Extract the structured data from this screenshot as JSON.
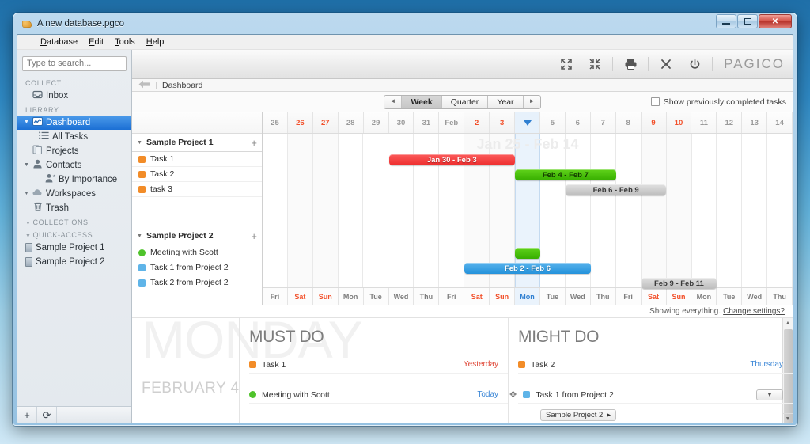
{
  "window": {
    "title": "A new database.pgco",
    "icon": "app-icon",
    "buttons": {
      "minimize": "–",
      "maximize": "□",
      "close": "✕"
    }
  },
  "menubar": [
    {
      "label": "Database",
      "accel": "D"
    },
    {
      "label": "Edit",
      "accel": "E"
    },
    {
      "label": "Tools",
      "accel": "T"
    },
    {
      "label": "Help",
      "accel": "H"
    }
  ],
  "sidebar": {
    "search_placeholder": "Type to search...",
    "sections": [
      {
        "header": "COLLECT",
        "collapsible": false,
        "items": [
          {
            "label": "Inbox",
            "icon": "inbox-icon",
            "glyph": "✉",
            "indent": 0,
            "twisty": "",
            "selected": false
          }
        ]
      },
      {
        "header": "LIBRARY",
        "collapsible": false,
        "items": [
          {
            "label": "Dashboard",
            "icon": "dashboard-icon",
            "glyph": "➤",
            "indent": 0,
            "twisty": "▼",
            "selected": true
          },
          {
            "label": "All Tasks",
            "icon": "list-icon",
            "glyph": "☰",
            "indent": 1,
            "twisty": "",
            "selected": false
          },
          {
            "label": "Projects",
            "icon": "projects-icon",
            "glyph": "❐",
            "indent": 0,
            "twisty": "",
            "selected": false
          },
          {
            "label": "Contacts",
            "icon": "contacts-icon",
            "glyph": "♟",
            "indent": 0,
            "twisty": "▼",
            "selected": false
          },
          {
            "label": "By Importance",
            "icon": "person-star-icon",
            "glyph": "♟",
            "indent": 2,
            "twisty": "",
            "selected": false
          },
          {
            "label": "Workspaces",
            "icon": "cloud-icon",
            "glyph": "☁",
            "indent": 0,
            "twisty": "▼",
            "selected": false
          },
          {
            "label": "Trash",
            "icon": "trash-icon",
            "glyph": "⌧",
            "indent": 0,
            "twisty": "",
            "selected": false
          }
        ]
      },
      {
        "header": "COLLECTIONS",
        "collapsible": true,
        "items": []
      },
      {
        "header": "QUICK-ACCESS",
        "collapsible": true,
        "items": [
          {
            "label": "Sample Project 1",
            "icon": "project-file-icon",
            "glyph": "",
            "indent": 0,
            "twisty": "",
            "selected": false
          },
          {
            "label": "Sample Project 2",
            "icon": "project-file-icon",
            "glyph": "",
            "indent": 0,
            "twisty": "",
            "selected": false
          }
        ]
      }
    ],
    "footer": {
      "add_label": "+",
      "refresh_label": "⟳"
    }
  },
  "toolbar": {
    "buttons": [
      {
        "name": "expand-icon",
        "glyph": "expand"
      },
      {
        "name": "collapse-icon",
        "glyph": "collapse"
      },
      {
        "name": "print-icon",
        "glyph": "print"
      },
      {
        "name": "tools-icon",
        "glyph": "tools"
      },
      {
        "name": "power-icon",
        "glyph": "power"
      }
    ],
    "brand": "PAGICO"
  },
  "breadcrumb": {
    "back": "⇦",
    "current": "Dashboard"
  },
  "gantt_toolbar": {
    "prev": "◄",
    "next": "►",
    "ranges": [
      {
        "label": "Week",
        "active": true
      },
      {
        "label": "Quarter",
        "active": false
      },
      {
        "label": "Year",
        "active": false
      }
    ],
    "show_completed_label": "Show previously completed tasks",
    "show_completed_checked": false
  },
  "chart_data": {
    "type": "gantt",
    "title": "Jan 25 - Feb 14",
    "range_watermark": "Jan 25 - Feb 14",
    "today_index": 10,
    "columns": [
      {
        "day": "25",
        "weekday": "Fri",
        "weekend": false
      },
      {
        "day": "26",
        "weekday": "Sat",
        "weekend": true
      },
      {
        "day": "27",
        "weekday": "Sun",
        "weekend": true
      },
      {
        "day": "28",
        "weekday": "Mon",
        "weekend": false
      },
      {
        "day": "29",
        "weekday": "Tue",
        "weekend": false
      },
      {
        "day": "30",
        "weekday": "Wed",
        "weekend": false
      },
      {
        "day": "31",
        "weekday": "Thu",
        "weekend": false
      },
      {
        "day": "Feb",
        "weekday": "Fri",
        "weekend": false
      },
      {
        "day": "2",
        "weekday": "Sat",
        "weekend": true
      },
      {
        "day": "3",
        "weekday": "Sun",
        "weekend": true
      },
      {
        "day": "4",
        "weekday": "Mon",
        "weekend": false
      },
      {
        "day": "5",
        "weekday": "Tue",
        "weekend": false
      },
      {
        "day": "6",
        "weekday": "Wed",
        "weekend": false
      },
      {
        "day": "7",
        "weekday": "Thu",
        "weekend": false
      },
      {
        "day": "8",
        "weekday": "Fri",
        "weekend": false
      },
      {
        "day": "9",
        "weekday": "Sat",
        "weekend": true
      },
      {
        "day": "10",
        "weekday": "Sun",
        "weekend": true
      },
      {
        "day": "11",
        "weekday": "Mon",
        "weekend": false
      },
      {
        "day": "12",
        "weekday": "Tue",
        "weekend": false
      },
      {
        "day": "13",
        "weekday": "Wed",
        "weekend": false
      },
      {
        "day": "14",
        "weekday": "Thu",
        "weekend": false
      }
    ],
    "groups": [
      {
        "name": "Sample Project 1",
        "add_label": "+",
        "twisty": "▼",
        "rows": [
          {
            "label": "Task 1",
            "marker": "square",
            "color": "#f28c28",
            "bar": {
              "label": "Jan 30 - Feb 3",
              "style": "red",
              "start": 5,
              "span": 5
            }
          },
          {
            "label": "Task 2",
            "marker": "square",
            "color": "#f28c28",
            "bar": {
              "label": "Feb 4 - Feb 7",
              "style": "green",
              "start": 10,
              "span": 4
            }
          },
          {
            "label": "task 3",
            "marker": "square",
            "color": "#f28c28",
            "bar": {
              "label": "Feb 6 - Feb 9",
              "style": "gray",
              "start": 12,
              "span": 4
            }
          },
          {
            "label": "",
            "marker": "none",
            "color": "",
            "bar": null
          },
          {
            "label": "",
            "marker": "none",
            "color": "",
            "bar": null
          }
        ]
      },
      {
        "name": "Sample Project 2",
        "add_label": "+",
        "twisty": "▼",
        "rows": [
          {
            "label": "Meeting with Scott",
            "marker": "circle",
            "color": "#4fc32b",
            "bar": {
              "label": "",
              "style": "green",
              "start": 10,
              "span": 1
            }
          },
          {
            "label": "Task 1 from Project 2",
            "marker": "square",
            "color": "#5fb4e8",
            "bar": {
              "label": "Feb 2 - Feb 6",
              "style": "blue",
              "start": 8,
              "span": 5
            }
          },
          {
            "label": "Task 2 from Project 2",
            "marker": "square",
            "color": "#5fb4e8",
            "bar": {
              "label": "Feb 9 - Feb 11",
              "style": "gray",
              "start": 15,
              "span": 3
            }
          }
        ]
      }
    ]
  },
  "showing": {
    "text": "Showing everything.",
    "link": "Change settings?"
  },
  "date_watermark": {
    "weekday": "MONDAY",
    "date": "FEBRUARY 4"
  },
  "panels": [
    {
      "title": "MUST DO",
      "items": [
        {
          "label": "Task 1",
          "marker": "square",
          "color": "#f28c28",
          "when": "Yesterday",
          "when_style": "red",
          "drag": false,
          "caret": false,
          "tag": null
        },
        {
          "label": "",
          "marker": "none",
          "color": "",
          "when": "",
          "when_style": "",
          "drag": false,
          "caret": false,
          "tag": null
        },
        {
          "label": "Meeting with Scott",
          "marker": "circle",
          "color": "#4fc32b",
          "when": "Today",
          "when_style": "blue",
          "drag": false,
          "caret": false,
          "tag": null
        }
      ]
    },
    {
      "title": "MIGHT DO",
      "items": [
        {
          "label": "Task 2",
          "marker": "square",
          "color": "#f28c28",
          "when": "Thursday",
          "when_style": "blue",
          "drag": false,
          "caret": false,
          "tag": null
        },
        {
          "label": "",
          "marker": "none",
          "color": "",
          "when": "",
          "when_style": "",
          "drag": false,
          "caret": false,
          "tag": null
        },
        {
          "label": "Task 1 from Project 2",
          "marker": "square",
          "color": "#5fb4e8",
          "when": "",
          "when_style": "",
          "drag": true,
          "caret": "▼",
          "tag": "Sample Project 2"
        }
      ]
    }
  ]
}
